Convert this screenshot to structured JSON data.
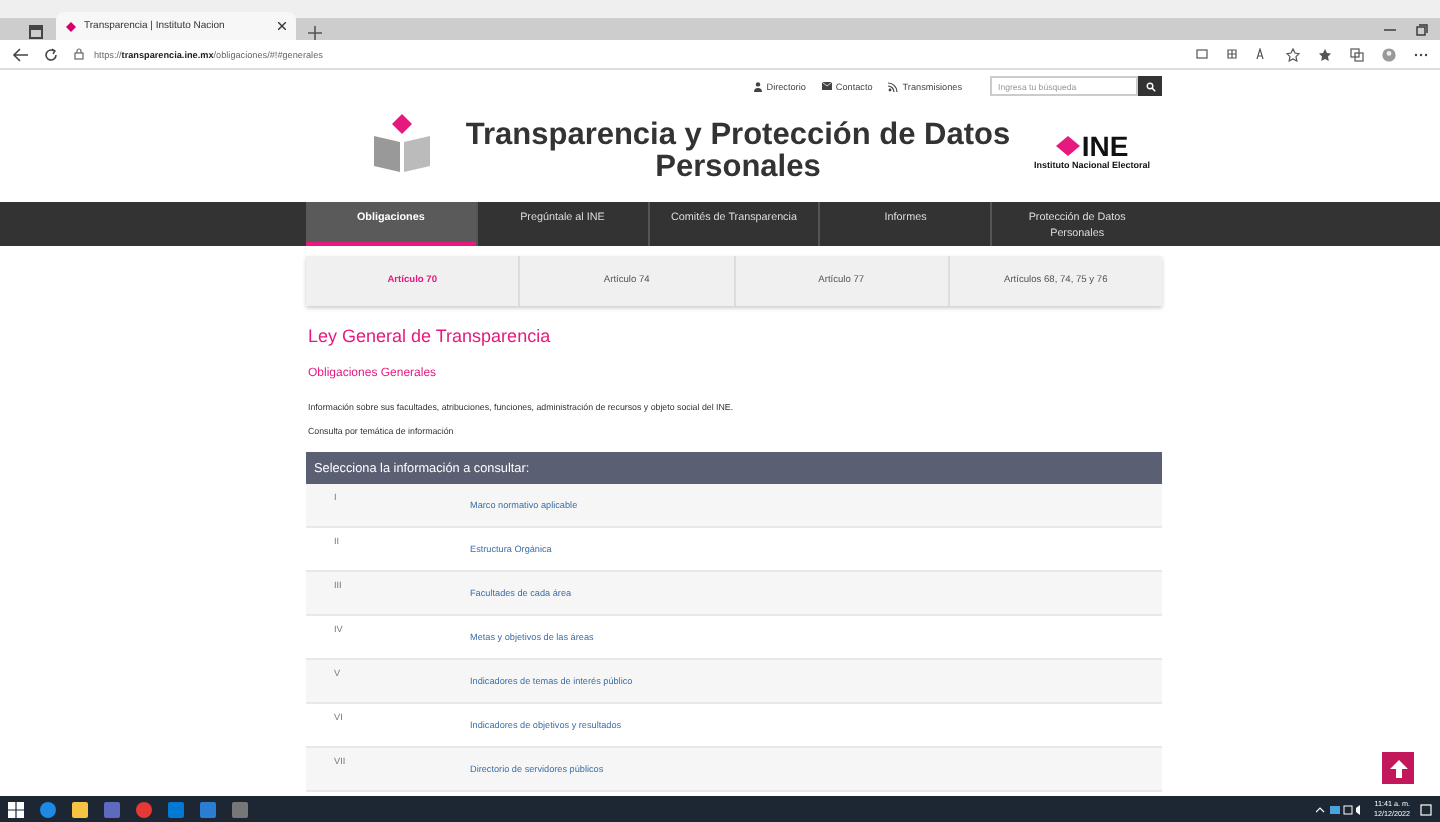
{
  "browser": {
    "tab_title": "Transparencia | Instituto Nacion",
    "url": "https://**transparencia.ine.mx**/obligaciones/#!#generales"
  },
  "header": {
    "links": [
      "Directorio",
      "Contacto",
      "Transmisiones"
    ],
    "search": {
      "placeholder": "Ingresa tu búsqueda"
    },
    "title": "Transparencia y Protección de Datos Personales",
    "logo_text": "INE",
    "logo_subtitle": "Instituto Nacional Electoral"
  },
  "nav": [
    {
      "label": "Obligaciones",
      "selected": true
    },
    {
      "label": "Pregúntale al INE",
      "selected": false
    },
    {
      "label": "Comités de Transparencia",
      "selected": false
    },
    {
      "label": "Informes",
      "selected": false
    },
    {
      "label": "Protección de Datos Personales",
      "selected": false
    }
  ],
  "subtabs": [
    {
      "label": "Artículo 70",
      "selected": true
    },
    {
      "label": "Artículo 74",
      "selected": false
    },
    {
      "label": "Artículo 77",
      "selected": false
    },
    {
      "label": "Artículos 68, 74, 75 y 76",
      "selected": false
    }
  ],
  "heading": "Ley General de Transparencia",
  "subheading": "Obligaciones Generales",
  "paragraphs": [
    "Información sobre sus facultades, atribuciones, funciones, administración de recursos y objeto social del INE.",
    "Consulta por temática de información"
  ],
  "table": {
    "header": "Selecciona la información a consultar:",
    "rows": [
      {
        "number": "I",
        "label": "Marco normativo aplicable"
      },
      {
        "number": "II",
        "label": "Estructura Orgánica"
      },
      {
        "number": "III",
        "label": "Facultades de cada área"
      },
      {
        "number": "IV",
        "label": "Metas y objetivos de las áreas"
      },
      {
        "number": "V",
        "label": "Indicadores de temas de interés público"
      },
      {
        "number": "VI",
        "label": "Indicadores de objetivos y resultados"
      },
      {
        "number": "VII",
        "label": "Directorio de servidores públicos"
      }
    ]
  },
  "taskbar": {
    "time": "11:41 a. m.",
    "date": "12/12/2022"
  }
}
